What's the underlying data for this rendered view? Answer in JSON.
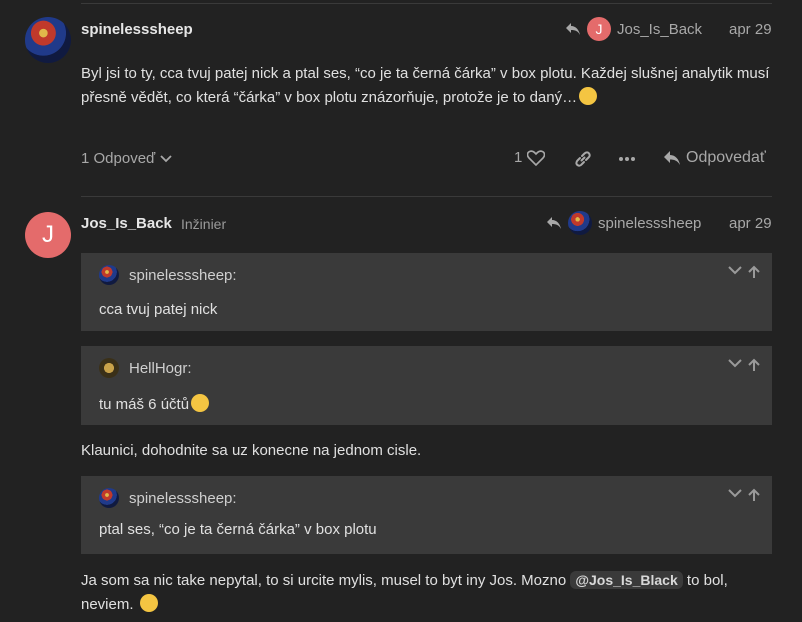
{
  "post1": {
    "username": "spinelesssheep",
    "reply_to_user": "Jos_Is_Back",
    "reply_to_avatar_letter": "J",
    "date": "apr 29",
    "body_line1": "Byl jsi to ty, cca tvuj patej nick a ptal ses, “co je ta černá čárka” v box plotu. Každej slušnej analytik musí",
    "body_line2": "přesně vědět, co která “čárka” v box plotu znázorňuje, protože je to daný…",
    "replies_label": "1 Odpoveď",
    "likes": "1",
    "reply_label": "Odpovedať"
  },
  "post2": {
    "avatar_letter": "J",
    "username": "Jos_Is_Back",
    "user_title": "Inžinier",
    "reply_to_user": "spinelesssheep",
    "date": "apr 29",
    "quotes": [
      {
        "author": "spinelesssheep:",
        "text": "cca tvuj patej nick"
      },
      {
        "author": "HellHogr:",
        "text": "tu máš 6 účtů"
      },
      {
        "author": "spinelesssheep:",
        "text": "ptal ses, “co je ta černá čárka” v box plotu"
      }
    ],
    "paragraph1": "Klaunici, dohodnite sa uz konecne na jednom cisle.",
    "paragraph2_start": "Ja som sa nic take nepytal, to si urcite mylis, musel to byt iny Jos. Mozno",
    "mention": "@Jos_Is_Black",
    "paragraph2_end": "to bol,",
    "paragraph2_line2": "neviem."
  }
}
